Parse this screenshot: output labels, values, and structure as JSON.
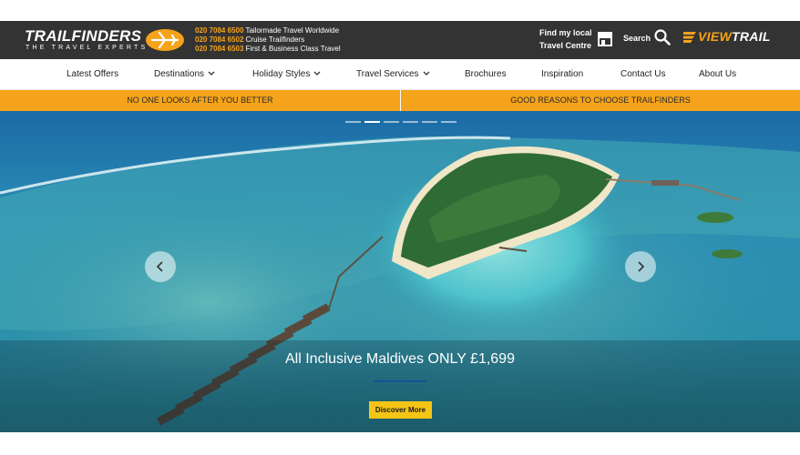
{
  "brand": {
    "name": "TRAILFINDERS",
    "tagline": "THE TRAVEL EXPERTS",
    "accent": "#f5a31a",
    "bar_color": "#333333"
  },
  "phones": [
    {
      "number": "020 7084 6500",
      "label": "Tailormade Travel Worldwide"
    },
    {
      "number": "020 7084 6502",
      "label": "Cruise Trailfinders"
    },
    {
      "number": "020 7084 6503",
      "label": "First & Business Class Travel"
    }
  ],
  "header": {
    "find_centre_line1": "Find my local",
    "find_centre_line2": "Travel Centre",
    "find_centre_icon": "shop-icon",
    "search_label": "Search",
    "search_icon": "search-icon",
    "viewtrail_part1": "VIEW",
    "viewtrail_part2": "TRAIL"
  },
  "nav": [
    {
      "label": "Latest Offers",
      "has_dropdown": false
    },
    {
      "label": "Destinations",
      "has_dropdown": true
    },
    {
      "label": "Holiday Styles",
      "has_dropdown": true
    },
    {
      "label": "Travel Services",
      "has_dropdown": true
    },
    {
      "label": "Brochures",
      "has_dropdown": false
    },
    {
      "label": "Inspiration",
      "has_dropdown": false
    },
    {
      "label": "Contact Us",
      "has_dropdown": false
    },
    {
      "label": "About Us",
      "has_dropdown": false
    }
  ],
  "strip": {
    "left": "NO ONE LOOKS AFTER YOU BETTER",
    "right": "GOOD REASONS TO CHOOSE TRAILFINDERS"
  },
  "hero": {
    "headline": "All Inclusive Maldives ONLY £1,699",
    "cta_label": "Discover More",
    "slide_count": 6,
    "active_slide": 2,
    "prev_icon": "chevron-left-icon",
    "next_icon": "chevron-right-icon",
    "cta_color": "#f5c516"
  }
}
